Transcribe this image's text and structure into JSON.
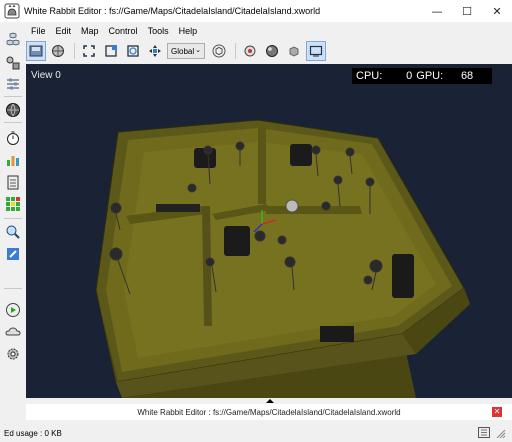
{
  "window": {
    "title": "White Rabbit Editor : fs://Game/Maps/CitadelaIsland/CitadelaIsland.xworld",
    "minimize": "—",
    "maximize": "☐",
    "close": "✕"
  },
  "menu": [
    "File",
    "Edit",
    "Map",
    "Control",
    "Tools",
    "Help"
  ],
  "toolbar": {
    "space_select": "Global"
  },
  "viewport": {
    "label": "View 0",
    "cpu_label": "CPU:",
    "cpu_value": "0",
    "gpu_label": "GPU:",
    "gpu_value": "68"
  },
  "output": {
    "text": "White Rabbit Editor : fs://Game/Maps/CitadelaIsland/CitadelaIsland.xworld",
    "close": "✕"
  },
  "status": {
    "text": "Ed usage : 0 KB"
  },
  "colors": {
    "viewport_bg": "#1a2236",
    "floor": "#6f6a1c",
    "wall": "#4f4c12"
  }
}
